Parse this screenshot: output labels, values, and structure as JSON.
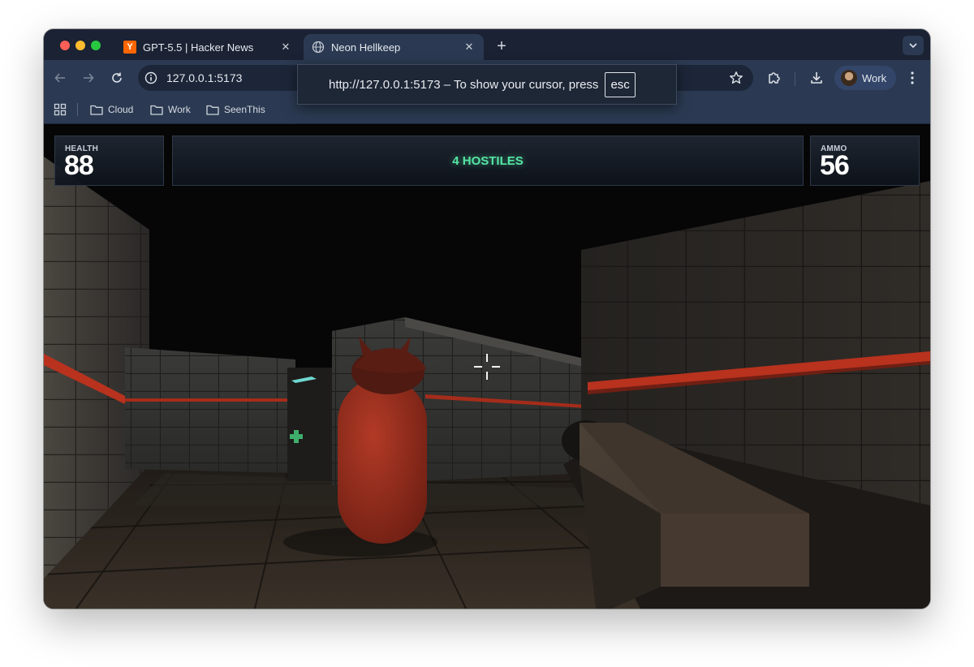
{
  "browser": {
    "tabs": [
      {
        "favicon": "Y",
        "title": "GPT-5.5 | Hacker News",
        "active": false
      },
      {
        "favicon": "globe-icon",
        "title": "Neon Hellkeep",
        "active": true
      }
    ],
    "omnibox": {
      "url": "127.0.0.1:5173"
    },
    "profile": {
      "label": "Work"
    },
    "bookmarks": [
      {
        "label": "Cloud"
      },
      {
        "label": "Work"
      },
      {
        "label": "SeenThis"
      }
    ]
  },
  "fullscreen_notice": {
    "text": "http://127.0.0.1:5173 – To show your cursor, press",
    "key": "esc"
  },
  "hud": {
    "health_label": "HEALTH",
    "health_value": "88",
    "hostiles_text": "4 HOSTILES",
    "ammo_label": "AMMO",
    "ammo_value": "56"
  },
  "colors": {
    "hostiles_text": "#55e6a4",
    "enemy": "#8f2a1d",
    "accent_stripe": "#b8321e"
  }
}
